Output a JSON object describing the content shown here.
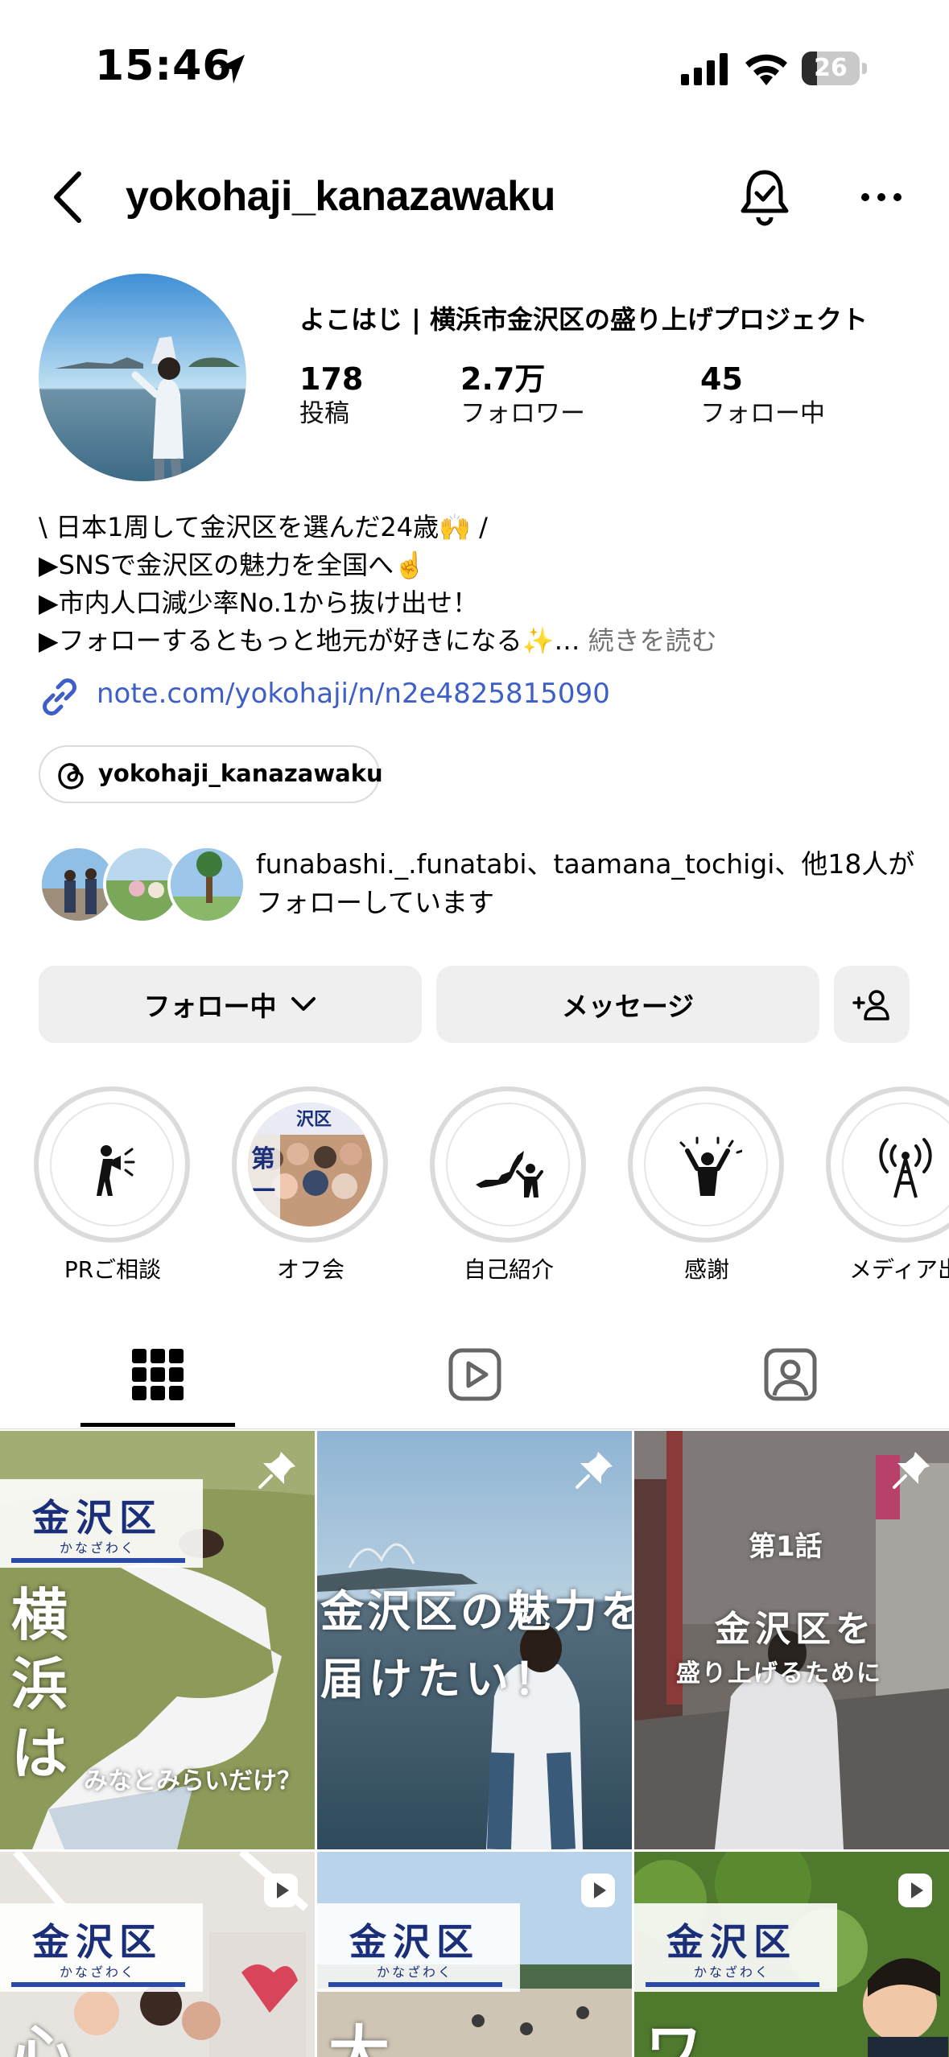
{
  "status_bar": {
    "time": "15:46",
    "battery": "26",
    "battery_level": 0.26
  },
  "header": {
    "username": "yokohaji_kanazawaku"
  },
  "profile": {
    "name": "よこはじ | 横浜市金沢区の盛り上げプロジェクト",
    "stats": [
      {
        "value": "178",
        "label": "投稿"
      },
      {
        "value": "2.7万",
        "label": "フォロワー"
      },
      {
        "value": "45",
        "label": "フォロー中"
      }
    ],
    "bio": [
      "\\ 日本1周して金沢区を選んだ24歳🙌 /",
      "▶SNSで金沢区の魅力を全国へ☝️",
      "▶市内人口減少率No.1から抜け出せ！",
      "▶フォローするともっと地元が好きになる✨…"
    ],
    "bio_more": "続きを読む",
    "link": "note.com/yokohaji/n/n2e4825815090",
    "threads": "yokohaji_kanazawaku",
    "followed_by": "funabashi._.funatabi、taamana_tochigi、他18人がフォローしています"
  },
  "buttons": {
    "following": "フォロー中",
    "message": "メッセージ"
  },
  "highlights": [
    {
      "label": "PRご相談",
      "icon": "megaphone-person-icon"
    },
    {
      "label": "オフ会",
      "icon": "photo"
    },
    {
      "label": "自己紹介",
      "icon": "japan-map-person-icon"
    },
    {
      "label": "感謝",
      "icon": "celebrating-person-icon"
    },
    {
      "label": "メディア出",
      "icon": "broadcast-tower-icon"
    }
  ],
  "tabs": [
    "grid-icon",
    "reels-icon",
    "tagged-icon"
  ],
  "posts": {
    "badge_title": "金沢区",
    "badge_sub": "かなざわく",
    "p1_vertical": "横\n浜\nは",
    "p1_small": "みなとみらいだけ？",
    "p2_line1": "金沢区の魅力を",
    "p2_line2": "届けたい！",
    "p3_episode": "第1話",
    "p3_line1": "金沢区を",
    "p3_line2": "盛り上げるために",
    "p4_char": "心",
    "p5_char": "大",
    "p6_char": "ワ"
  },
  "colors": {
    "link": "#3d5fc7",
    "badge_navy": "#1b2e7a",
    "button_bg": "#efefef"
  }
}
